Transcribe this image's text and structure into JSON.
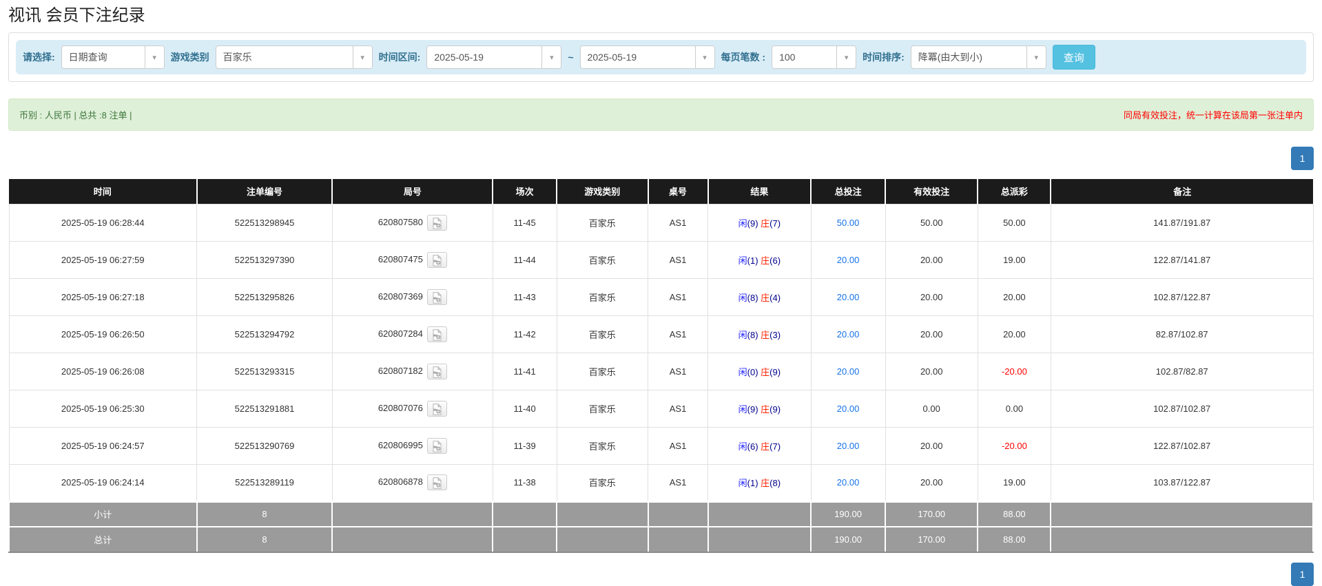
{
  "page": {
    "title": "视讯 会员下注纪录"
  },
  "filters": {
    "select_label": "请选择:",
    "select_value": "日期查询",
    "game_label": "游戏类别",
    "game_value": "百家乐",
    "range_label": "时间区间:",
    "date_from": "2025-05-19",
    "tilde": "~",
    "date_to": "2025-05-19",
    "per_page_label": "每页笔数 :",
    "per_page_value": "100",
    "sort_label": "时间排序:",
    "sort_value": "降冪(由大到小)",
    "query_button": "查询"
  },
  "summary": {
    "left": "币别 : 人民币 | 总共 :8 注单 |",
    "right": "同局有效投注，统一计算在该局第一张注单内"
  },
  "pagination": {
    "current_page": "1"
  },
  "icons": {
    "chevron_down": "▾"
  },
  "colors": {
    "accent_blue": "#337ab7",
    "link_blue": "#1673e8",
    "query_button_cyan": "#55c1e1",
    "filter_bg": "#d9edf7",
    "summary_bg": "#dff0d8",
    "summary_text": "#3c763d",
    "notice_red": "#ff0000",
    "header_bg": "#1b1b1b",
    "footer_bg": "#9b9b9b",
    "result_player_blue": "#2222ff",
    "result_banker_red": "#ff2200",
    "negative_red": "#ff0000"
  },
  "table": {
    "headers": [
      "时间",
      "注单编号",
      "局号",
      "场次",
      "游戏类别",
      "桌号",
      "结果",
      "总投注",
      "有效投注",
      "总派彩",
      "备注"
    ],
    "rows": [
      {
        "time": "2025-05-19 06:28:44",
        "bet_no": "522513298945",
        "round_no": "620807580",
        "session": "11-45",
        "game": "百家乐",
        "table_no": "AS1",
        "result": {
          "player": "闲",
          "player_num": "(9)",
          "banker": "庄",
          "banker_num": "(7)"
        },
        "total_bet": "50.00",
        "valid_bet": "50.00",
        "payout": "50.00",
        "payout_negative": false,
        "remark": "141.87/191.87"
      },
      {
        "time": "2025-05-19 06:27:59",
        "bet_no": "522513297390",
        "round_no": "620807475",
        "session": "11-44",
        "game": "百家乐",
        "table_no": "AS1",
        "result": {
          "player": "闲",
          "player_num": "(1)",
          "banker": "庄",
          "banker_num": "(6)"
        },
        "total_bet": "20.00",
        "valid_bet": "20.00",
        "payout": "19.00",
        "payout_negative": false,
        "remark": "122.87/141.87"
      },
      {
        "time": "2025-05-19 06:27:18",
        "bet_no": "522513295826",
        "round_no": "620807369",
        "session": "11-43",
        "game": "百家乐",
        "table_no": "AS1",
        "result": {
          "player": "闲",
          "player_num": "(8)",
          "banker": "庄",
          "banker_num": "(4)"
        },
        "total_bet": "20.00",
        "valid_bet": "20.00",
        "payout": "20.00",
        "payout_negative": false,
        "remark": "102.87/122.87"
      },
      {
        "time": "2025-05-19 06:26:50",
        "bet_no": "522513294792",
        "round_no": "620807284",
        "session": "11-42",
        "game": "百家乐",
        "table_no": "AS1",
        "result": {
          "player": "闲",
          "player_num": "(8)",
          "banker": "庄",
          "banker_num": "(3)"
        },
        "total_bet": "20.00",
        "valid_bet": "20.00",
        "payout": "20.00",
        "payout_negative": false,
        "remark": "82.87/102.87"
      },
      {
        "time": "2025-05-19 06:26:08",
        "bet_no": "522513293315",
        "round_no": "620807182",
        "session": "11-41",
        "game": "百家乐",
        "table_no": "AS1",
        "result": {
          "player": "闲",
          "player_num": "(0)",
          "banker": "庄",
          "banker_num": "(9)"
        },
        "total_bet": "20.00",
        "valid_bet": "20.00",
        "payout": "-20.00",
        "payout_negative": true,
        "remark": "102.87/82.87"
      },
      {
        "time": "2025-05-19 06:25:30",
        "bet_no": "522513291881",
        "round_no": "620807076",
        "session": "11-40",
        "game": "百家乐",
        "table_no": "AS1",
        "result": {
          "player": "闲",
          "player_num": "(9)",
          "banker": "庄",
          "banker_num": "(9)"
        },
        "total_bet": "20.00",
        "valid_bet": "0.00",
        "payout": "0.00",
        "payout_negative": false,
        "remark": "102.87/102.87"
      },
      {
        "time": "2025-05-19 06:24:57",
        "bet_no": "522513290769",
        "round_no": "620806995",
        "session": "11-39",
        "game": "百家乐",
        "table_no": "AS1",
        "result": {
          "player": "闲",
          "player_num": "(6)",
          "banker": "庄",
          "banker_num": "(7)"
        },
        "total_bet": "20.00",
        "valid_bet": "20.00",
        "payout": "-20.00",
        "payout_negative": true,
        "remark": "122.87/102.87"
      },
      {
        "time": "2025-05-19 06:24:14",
        "bet_no": "522513289119",
        "round_no": "620806878",
        "session": "11-38",
        "game": "百家乐",
        "table_no": "AS1",
        "result": {
          "player": "闲",
          "player_num": "(1)",
          "banker": "庄",
          "banker_num": "(8)"
        },
        "total_bet": "20.00",
        "valid_bet": "20.00",
        "payout": "19.00",
        "payout_negative": false,
        "remark": "103.87/122.87"
      }
    ],
    "footer_rows": [
      {
        "label": "小计",
        "count": "8",
        "total_bet": "190.00",
        "valid_bet": "170.00",
        "payout": "88.00"
      },
      {
        "label": "总计",
        "count": "8",
        "total_bet": "190.00",
        "valid_bet": "170.00",
        "payout": "88.00"
      }
    ]
  }
}
